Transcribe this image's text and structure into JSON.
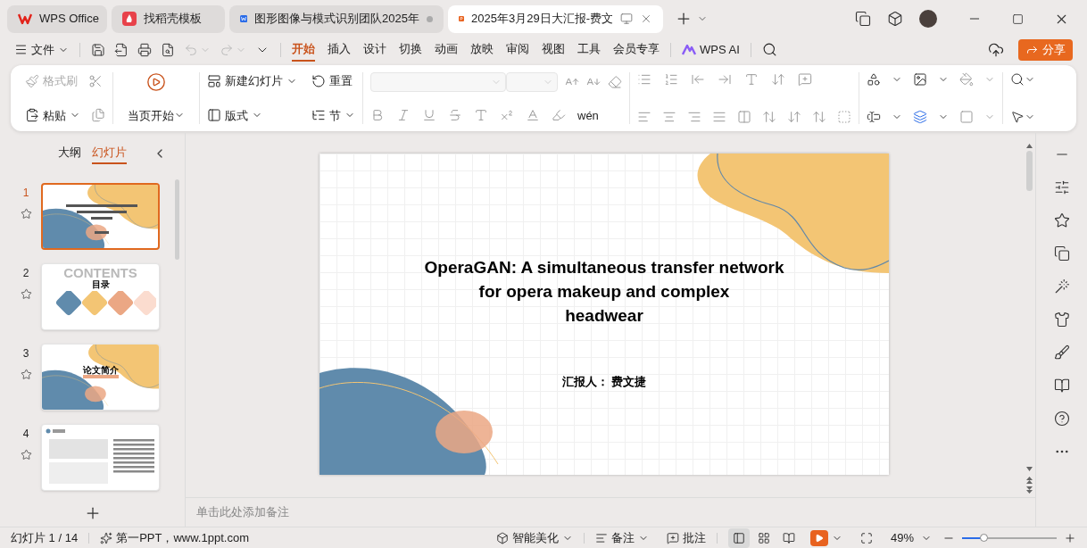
{
  "window_tabs": [
    {
      "label": "WPS Office",
      "kind": "home",
      "selected": false,
      "unsaved": false
    },
    {
      "label": "找稻壳模板",
      "kind": "template",
      "selected": false,
      "unsaved": false
    },
    {
      "label": "图形图像与模式识别团队2025年",
      "kind": "writer",
      "selected": false,
      "unsaved": true
    },
    {
      "label": "2025年3月29日大汇报-费文",
      "kind": "slides",
      "selected": true,
      "unsaved": false
    }
  ],
  "menu": {
    "file": "文件",
    "tabs": [
      {
        "label": "开始",
        "selected": true
      },
      {
        "label": "插入",
        "selected": false
      },
      {
        "label": "设计",
        "selected": false
      },
      {
        "label": "切换",
        "selected": false
      },
      {
        "label": "动画",
        "selected": false
      },
      {
        "label": "放映",
        "selected": false
      },
      {
        "label": "审阅",
        "selected": false
      },
      {
        "label": "视图",
        "selected": false
      },
      {
        "label": "工具",
        "selected": false
      },
      {
        "label": "会员专享",
        "selected": false
      }
    ],
    "ai": "WPS AI",
    "share": "分享"
  },
  "ribbon": {
    "format_painter": {
      "label": "格式刷",
      "disabled": true
    },
    "paste": "粘贴",
    "play_from_current": "当页开始",
    "new_slide": "新建幻灯片",
    "reset": "重置",
    "layout": "版式",
    "section": "节",
    "pinyin": "wén"
  },
  "left_panel": {
    "tabs": [
      {
        "label": "大纲",
        "selected": false
      },
      {
        "label": "幻灯片",
        "selected": true
      }
    ],
    "thumbnails": [
      {
        "number": "1",
        "kind": "title",
        "selected": true
      },
      {
        "number": "2",
        "kind": "contents",
        "selected": false,
        "backdrop": "CONTENTS",
        "title": "目录"
      },
      {
        "number": "3",
        "kind": "section",
        "selected": false,
        "title": "论文简介"
      },
      {
        "number": "4",
        "kind": "text",
        "selected": false
      }
    ]
  },
  "slide": {
    "title_lines": [
      "OperaGAN: A simultaneous transfer network",
      "for opera makeup and complex",
      "headwear"
    ],
    "presenter": "汇报人： 费文捷"
  },
  "notes": {
    "placeholder": "单击此处添加备注"
  },
  "status_bar": {
    "slide_counter": "幻灯片 1 / 14",
    "template": "第一PPT，www.1ppt.com",
    "beautify": "智能美化",
    "notes": "备注",
    "comments": "批注",
    "views": [
      {
        "kind": "normal",
        "selected": true
      },
      {
        "kind": "sorter",
        "selected": false
      },
      {
        "kind": "reading",
        "selected": false
      }
    ],
    "zoom": "49%",
    "zoom_slider": {
      "level": 0.23
    }
  }
}
